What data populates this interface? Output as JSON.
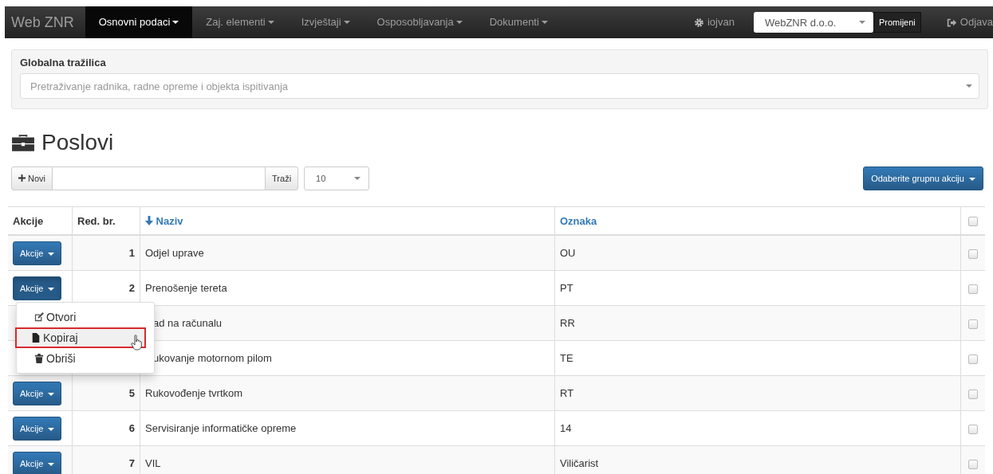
{
  "navbar": {
    "brand": "Web ZNR",
    "menus": [
      {
        "label": "Osnovni podaci",
        "selected": true
      },
      {
        "label": "Zaj. elementi",
        "selected": false
      },
      {
        "label": "Izvještaji",
        "selected": false
      },
      {
        "label": "Osposobljavanja",
        "selected": false
      },
      {
        "label": "Dokumenti",
        "selected": false
      }
    ],
    "user": "iojvan",
    "company": "WebZNR d.o.o.",
    "change_button": "Promijeni",
    "logout": "Odjava"
  },
  "global_search": {
    "title": "Globalna tražilica",
    "placeholder": "Pretraživanje radnika, radne opreme i objekta ispitivanja"
  },
  "page_title": "Poslovi",
  "toolbar": {
    "new_button": "Novi",
    "search_button": "Traži",
    "page_size": "10",
    "group_action": "Odaberite grupnu akciju"
  },
  "table": {
    "columns": [
      "Akcije",
      "Red. br.",
      "Naziv",
      "Oznaka"
    ],
    "all_checked": false,
    "rows": [
      {
        "action": "Akcije",
        "open": false,
        "number": "1",
        "name": "Odjel uprave",
        "code": "OU",
        "checked": false
      },
      {
        "action": "Akcije",
        "open": true,
        "number": "2",
        "name": "Prenošenje tereta",
        "code": "PT",
        "checked": false
      },
      {
        "name": "ad na računalu",
        "code": "RR",
        "checked": false
      },
      {
        "name": "ukovanje motornom pilom",
        "code": "TE",
        "checked": false
      },
      {
        "action": "Akcije",
        "open": false,
        "number": "5",
        "name": "Rukovođenje tvrtkom",
        "code": "RT",
        "checked": false
      },
      {
        "action": "Akcije",
        "open": false,
        "number": "6",
        "name": "Servisiranje informatičke opreme",
        "code": "14",
        "checked": false
      },
      {
        "action": "Akcije",
        "open": false,
        "number": "7",
        "name": "VIL",
        "code": "Viličarist",
        "checked": false
      }
    ]
  },
  "action_menu": [
    {
      "kind": "edit",
      "label": "Otvori",
      "selected": false
    },
    {
      "kind": "copy",
      "label": "Kopiraj",
      "selected": true
    },
    {
      "kind": "delete",
      "label": "Obriši",
      "selected": false
    }
  ]
}
